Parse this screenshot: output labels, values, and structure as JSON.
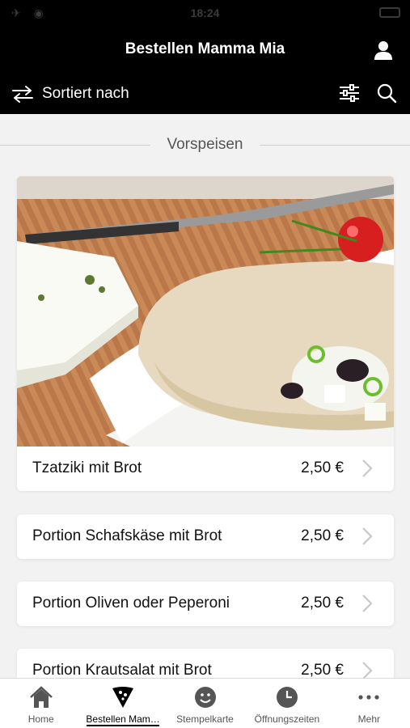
{
  "status_bar": {
    "time": "18:24",
    "left": "✈ ◉"
  },
  "header": {
    "title": "Bestellen Mamma Mia"
  },
  "toolbar": {
    "sort_label": "Sortiert nach"
  },
  "section": {
    "title": "Vorspeisen"
  },
  "items": [
    {
      "name": "Tzatziki mit Brot",
      "price": "2,50 €"
    },
    {
      "name": "Portion Schafskäse mit Brot",
      "price": "2,50 €"
    },
    {
      "name": "Portion Oliven oder Peperoni",
      "price": "2,50 €"
    },
    {
      "name": "Portion Krautsalat mit Brot",
      "price": "2,50 €"
    }
  ],
  "bottom_nav": [
    {
      "label": "Home",
      "icon": "home-icon"
    },
    {
      "label": "Bestellen Mam…",
      "icon": "pizza-slice-icon",
      "active": true
    },
    {
      "label": "Stempelkarte",
      "icon": "smiley-icon"
    },
    {
      "label": "Öffnungszeiten",
      "icon": "clock-icon"
    },
    {
      "label": "Mehr",
      "icon": "more-dots-icon"
    }
  ],
  "colors": {
    "header_bg": "#000000",
    "page_bg": "#f2f2f2",
    "card_bg": "#ffffff",
    "nav_active": "#000000",
    "nav_inactive": "#555555"
  }
}
